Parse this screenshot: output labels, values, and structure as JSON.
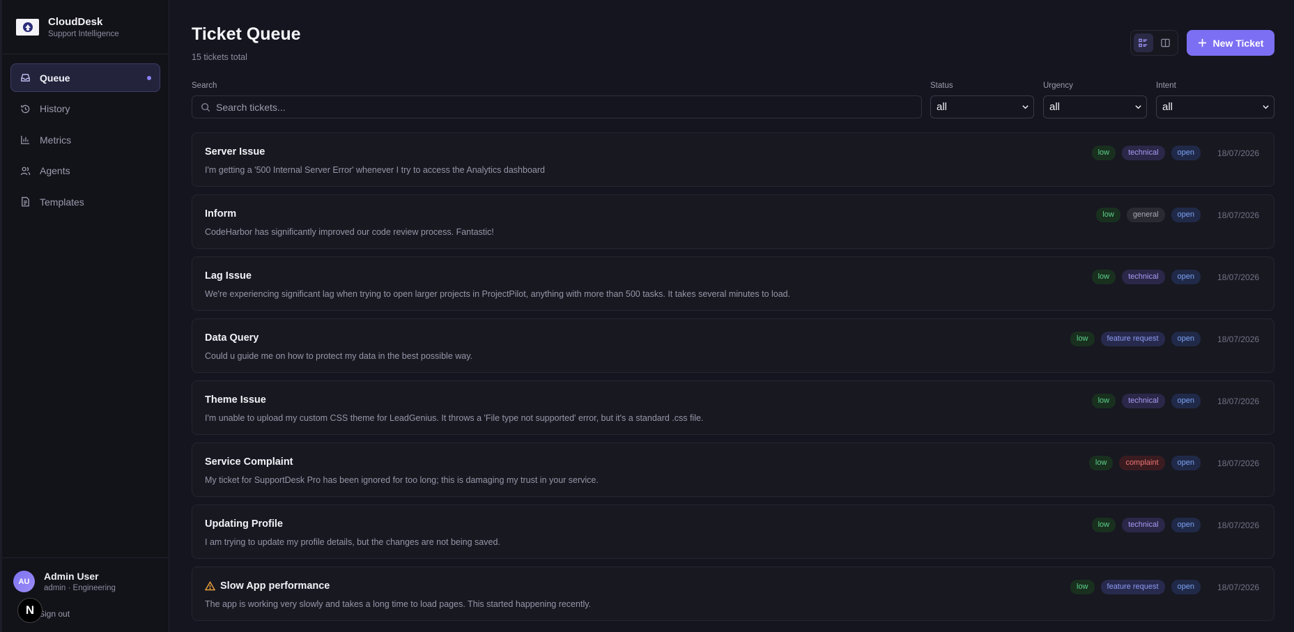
{
  "brand": {
    "name": "CloudDesk",
    "subtitle": "Support Intelligence"
  },
  "nav": [
    {
      "label": "Queue",
      "icon": "inbox-icon",
      "active": true
    },
    {
      "label": "History",
      "icon": "history-icon"
    },
    {
      "label": "Metrics",
      "icon": "bar-chart-icon"
    },
    {
      "label": "Agents",
      "icon": "users-icon"
    },
    {
      "label": "Templates",
      "icon": "file-text-icon"
    }
  ],
  "user": {
    "initials": "AU",
    "name": "Admin User",
    "role": "admin · Engineering",
    "signout": "Sign out",
    "badge": "N"
  },
  "header": {
    "title": "Ticket Queue",
    "subtitle": "15 tickets total",
    "new_ticket": "New Ticket"
  },
  "filters": {
    "search_label": "Search",
    "search_placeholder": "Search tickets...",
    "status_label": "Status",
    "status_value": "all",
    "urgency_label": "Urgency",
    "urgency_value": "all",
    "intent_label": "Intent",
    "intent_value": "all"
  },
  "tickets": [
    {
      "title": "Server Issue",
      "desc": "I'm getting a '500 Internal Server Error' whenever I try to access the Analytics dashboard",
      "urgency": "low",
      "intent": "technical",
      "status": "open",
      "date": "18/07/2026"
    },
    {
      "title": "Inform",
      "desc": "CodeHarbor has significantly improved our code review process. Fantastic!",
      "urgency": "low",
      "intent": "general",
      "status": "open",
      "date": "18/07/2026"
    },
    {
      "title": "Lag Issue",
      "desc": "We're experiencing significant lag when trying to open larger projects in ProjectPilot, anything with more than 500 tasks. It takes several minutes to load.",
      "urgency": "low",
      "intent": "technical",
      "status": "open",
      "date": "18/07/2026"
    },
    {
      "title": "Data Query",
      "desc": "Could u guide me on how to protect my data in the best possible way.",
      "urgency": "low",
      "intent": "feature request",
      "status": "open",
      "date": "18/07/2026"
    },
    {
      "title": "Theme Issue",
      "desc": "I'm unable to upload my custom CSS theme for LeadGenius. It throws a 'File type not supported' error, but it's a standard .css file.",
      "urgency": "low",
      "intent": "technical",
      "status": "open",
      "date": "18/07/2026"
    },
    {
      "title": "Service Complaint",
      "desc": "My ticket for SupportDesk Pro has been ignored for too long; this is damaging my trust in your service.",
      "urgency": "low",
      "intent": "complaint",
      "status": "open",
      "date": "18/07/2026"
    },
    {
      "title": "Updating Profile",
      "desc": "I am trying to update my profile details, but the changes are not being saved.",
      "urgency": "low",
      "intent": "technical",
      "status": "open",
      "date": "18/07/2026"
    },
    {
      "title": "Slow App performance",
      "desc": "The app is working very slowly and takes a long time to load pages. This started happening recently.",
      "urgency": "low",
      "intent": "feature request",
      "status": "open",
      "date": "18/07/2026",
      "warning": true
    }
  ]
}
